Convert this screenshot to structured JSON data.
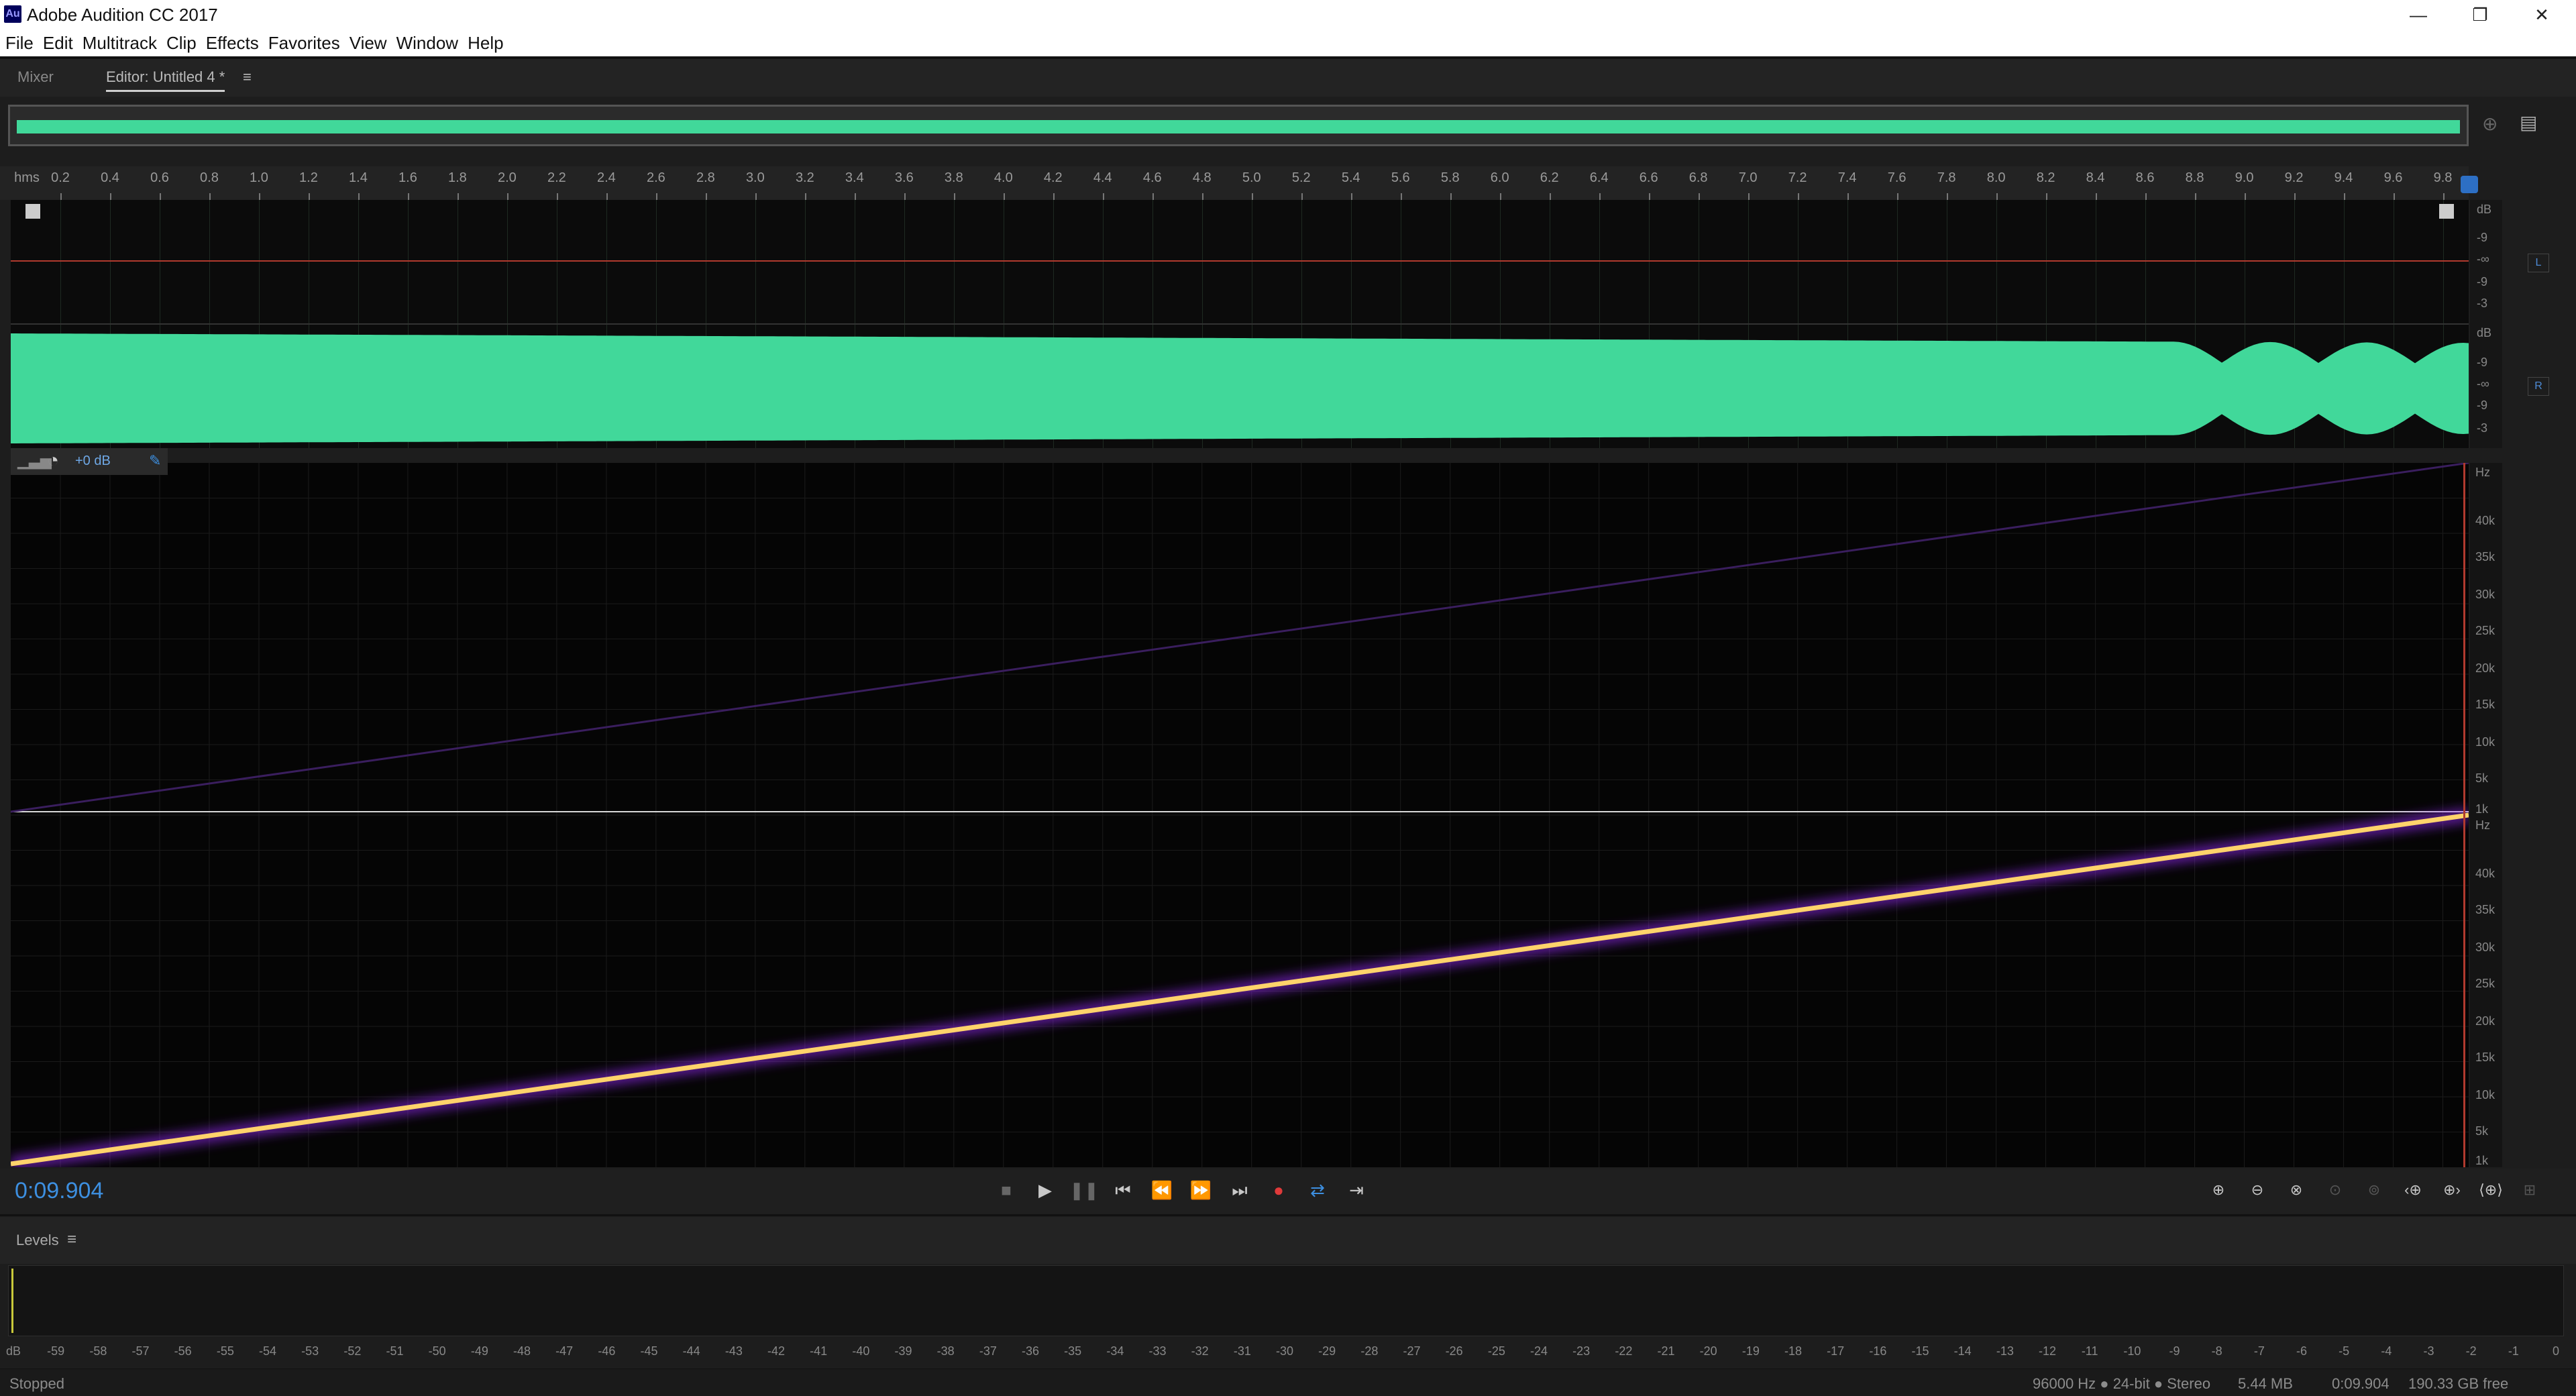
{
  "window": {
    "title": "Adobe Audition CC 2017",
    "icon_text": "Au",
    "minimize_glyph": "—",
    "restore_glyph": "❐",
    "close_glyph": "✕"
  },
  "menu": [
    "File",
    "Edit",
    "Multitrack",
    "Clip",
    "Effects",
    "Favorites",
    "View",
    "Window",
    "Help"
  ],
  "panels": {
    "mixer_tab": "Mixer",
    "editor_tab": "Editor: Untitled 4 *",
    "editor_menu_icon": "≡"
  },
  "ruler": {
    "unit": "hms",
    "labels": [
      "0.2",
      "0.4",
      "0.6",
      "0.8",
      "1.0",
      "1.2",
      "1.4",
      "1.6",
      "1.8",
      "2.0",
      "2.2",
      "2.4",
      "2.6",
      "2.8",
      "3.0",
      "3.2",
      "3.4",
      "3.6",
      "3.8",
      "4.0",
      "4.2",
      "4.4",
      "4.6",
      "4.8",
      "5.0",
      "5.2",
      "5.4",
      "5.6",
      "5.8",
      "6.0",
      "6.2",
      "6.4",
      "6.6",
      "6.8",
      "7.0",
      "7.2",
      "7.4",
      "7.6",
      "7.8",
      "8.0",
      "8.2",
      "8.4",
      "8.6",
      "8.8",
      "9.0",
      "9.2",
      "9.4",
      "9.6",
      "9.8"
    ],
    "total_seconds": 9.904
  },
  "waveform": {
    "db_scale_l": [
      "dB",
      "-9",
      "-∞",
      "-9",
      "-3"
    ],
    "db_scale_r": [
      "dB",
      "-9",
      "-∞",
      "-9",
      "-3"
    ],
    "channel_l": "L",
    "channel_r": "R",
    "wave_color": "#41d89a",
    "clip_line_color": "#b03a2e"
  },
  "spectral": {
    "gain_label": "+0 dB",
    "hz_scale_top": [
      "Hz",
      "40k",
      "35k",
      "30k",
      "25k",
      "20k",
      "15k",
      "10k",
      "5k",
      "1k"
    ],
    "hz_scale_bottom": [
      "Hz",
      "40k",
      "35k",
      "30k",
      "25k",
      "20k",
      "15k",
      "10k",
      "5k",
      "1k"
    ],
    "sweep_color": "#ffd36b",
    "glow_color": "#9b2cff"
  },
  "transport": {
    "time": "0:09.904",
    "buttons": {
      "stop": "■",
      "play": "▶",
      "pause": "❚❚",
      "to_start": "⏮",
      "rewind": "⏪",
      "forward": "⏩",
      "to_end": "⏭",
      "record": "●",
      "loop": "⇄",
      "skip": "⇥"
    },
    "zoom_buttons": [
      "⊕",
      "⊖",
      "⊗",
      "⊙",
      "⊚",
      "‹⊕",
      "⊕›",
      "⟨⊕⟩",
      "⊞"
    ]
  },
  "levels": {
    "title": "Levels",
    "menu_icon": "≡",
    "scale": [
      "dB",
      "-59",
      "-58",
      "-57",
      "-56",
      "-55",
      "-54",
      "-53",
      "-52",
      "-51",
      "-50",
      "-49",
      "-48",
      "-47",
      "-46",
      "-45",
      "-44",
      "-43",
      "-42",
      "-41",
      "-40",
      "-39",
      "-38",
      "-37",
      "-36",
      "-35",
      "-34",
      "-33",
      "-32",
      "-31",
      "-30",
      "-29",
      "-28",
      "-27",
      "-26",
      "-25",
      "-24",
      "-23",
      "-22",
      "-21",
      "-20",
      "-19",
      "-18",
      "-17",
      "-16",
      "-15",
      "-14",
      "-13",
      "-12",
      "-11",
      "-10",
      "-9",
      "-8",
      "-7",
      "-6",
      "-5",
      "-4",
      "-3",
      "-2",
      "-1",
      "0"
    ]
  },
  "status": {
    "state": "Stopped",
    "format": "96000 Hz ● 24-bit ● Stereo",
    "size": "5.44 MB",
    "duration": "0:09.904",
    "free": "190.33 GB free"
  }
}
